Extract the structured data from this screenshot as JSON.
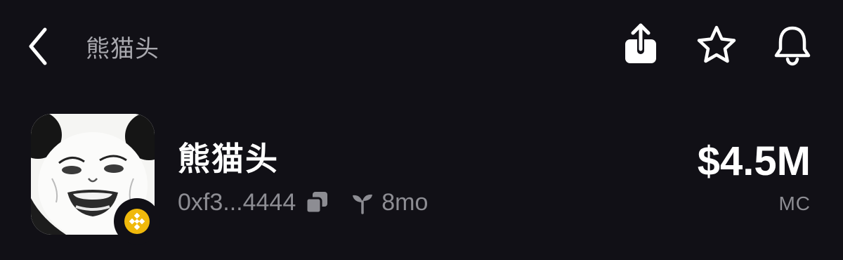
{
  "header": {
    "title": "熊猫头",
    "actions": [
      {
        "name": "share",
        "icon": "share-icon"
      },
      {
        "name": "favorite",
        "icon": "star-icon"
      },
      {
        "name": "alerts",
        "icon": "bell-icon"
      }
    ]
  },
  "token": {
    "name": "熊猫头",
    "address": "0xf3...4444",
    "age": "8mo",
    "chain_badge_color": "#f0b90b",
    "market_cap": "$4.5M",
    "market_cap_label": "MC"
  },
  "colors": {
    "background": "#111016",
    "primary_text": "#ffffff",
    "secondary_text": "#8d8d93"
  }
}
